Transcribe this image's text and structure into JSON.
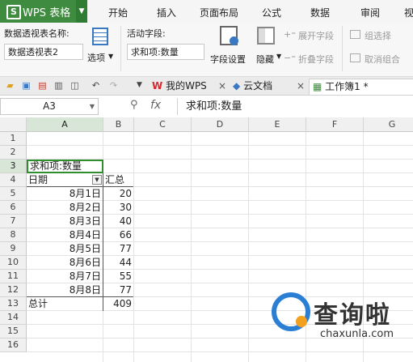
{
  "app": {
    "title": "WPS 表格",
    "logo": "S"
  },
  "menu": {
    "tabs": [
      "开始",
      "插入",
      "页面布局",
      "公式",
      "数据",
      "审阅",
      "视"
    ]
  },
  "ribbon": {
    "pivot_name_label": "数据透视表名称:",
    "pivot_name_value": "数据透视表2",
    "options_label": "选项",
    "active_field_label": "活动字段:",
    "active_field_value": "求和项:数量",
    "field_settings_label": "字段设置",
    "hide_label": "隐藏",
    "expand_field_label": "展开字段",
    "collapse_field_label": "折叠字段",
    "group_selection_label": "组选择",
    "ungroup_label": "取消组合"
  },
  "doc_tabs": {
    "wps_label": "我的WPS",
    "cloud_label": "云文档",
    "workbook_label": "工作簿1 *",
    "close": "×"
  },
  "formula_bar": {
    "cell_ref": "A3",
    "fx": "fx",
    "content": "求和项:数量"
  },
  "sheet": {
    "columns": [
      "A",
      "B",
      "C",
      "D",
      "E",
      "F",
      "G"
    ],
    "rows": [
      "1",
      "2",
      "3",
      "4",
      "5",
      "6",
      "7",
      "8",
      "9",
      "10",
      "11",
      "12",
      "13",
      "14",
      "15",
      "16"
    ],
    "pivot_header": "求和项:数量",
    "date_header": "日期",
    "total_header": "汇总",
    "dates": [
      "8月1日",
      "8月2日",
      "8月3日",
      "8月4日",
      "8月5日",
      "8月6日",
      "8月7日",
      "8月8日"
    ],
    "values": [
      "20",
      "30",
      "40",
      "66",
      "77",
      "44",
      "55",
      "77"
    ],
    "grand_total_label": "总计",
    "grand_total_value": "409"
  },
  "watermark": {
    "name": "查询啦",
    "url": "chaxunla.com"
  },
  "colors": {
    "brand": "#3f8b3f",
    "selection": "#2f8f2f"
  }
}
